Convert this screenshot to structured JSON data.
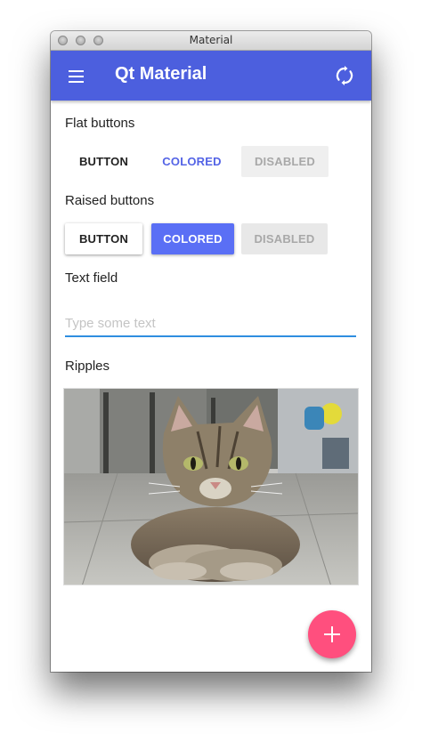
{
  "window": {
    "title": "Material"
  },
  "appbar": {
    "title": "Qt Material",
    "menu_icon": "hamburger-menu-icon",
    "action_icon": "refresh-icon",
    "color": "#4c5fde"
  },
  "flat_buttons": {
    "label": "Flat buttons",
    "button": "BUTTON",
    "colored": "COLORED",
    "disabled": "DISABLED"
  },
  "raised_buttons": {
    "label": "Raised buttons",
    "button": "BUTTON",
    "colored": "COLORED",
    "disabled": "DISABLED"
  },
  "text_field": {
    "label": "Text field",
    "placeholder": "Type some text",
    "value": ""
  },
  "ripples": {
    "label": "Ripples"
  },
  "fab": {
    "icon": "plus-icon",
    "color": "#ff4f7e"
  }
}
